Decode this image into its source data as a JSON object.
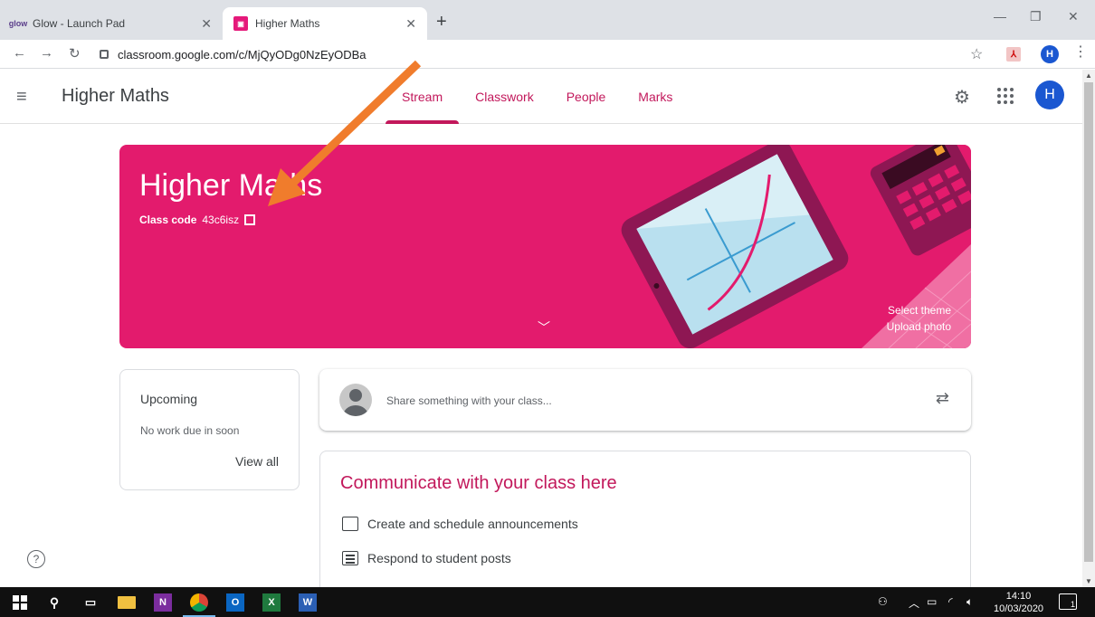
{
  "browser": {
    "tabs": [
      {
        "label": "Glow - Launch Pad",
        "favicon": "glow-icon",
        "favicon_text": "glow"
      },
      {
        "label": "Higher Maths",
        "favicon": "google-classroom-icon",
        "favicon_text": "▣"
      }
    ],
    "url": "classroom.google.com/c/MjQyODg0NzEyODBa",
    "profile_initial": "H"
  },
  "header": {
    "class_name": "Higher Maths",
    "tabs": [
      "Stream",
      "Classwork",
      "People",
      "Marks"
    ],
    "active_tab": "Stream",
    "avatar_initial": "H"
  },
  "banner": {
    "title": "Higher Maths",
    "class_code_label": "Class code",
    "class_code": "43c6isz",
    "select_theme": "Select theme",
    "upload_photo": "Upload photo",
    "color": "#e31b6d"
  },
  "upcoming": {
    "title": "Upcoming",
    "empty_text": "No work due in soon",
    "view_all": "View all"
  },
  "share": {
    "placeholder": "Share something with your class..."
  },
  "communicate": {
    "title": "Communicate with your class here",
    "items": [
      "Create and schedule announcements",
      "Respond to student posts"
    ]
  },
  "taskbar": {
    "time": "14:10",
    "date": "10/03/2020",
    "notifications": "1"
  },
  "colors": {
    "accent": "#c2185b",
    "banner": "#e31b6d",
    "arrow": "#f07c2c",
    "profile": "#1a57d1"
  }
}
